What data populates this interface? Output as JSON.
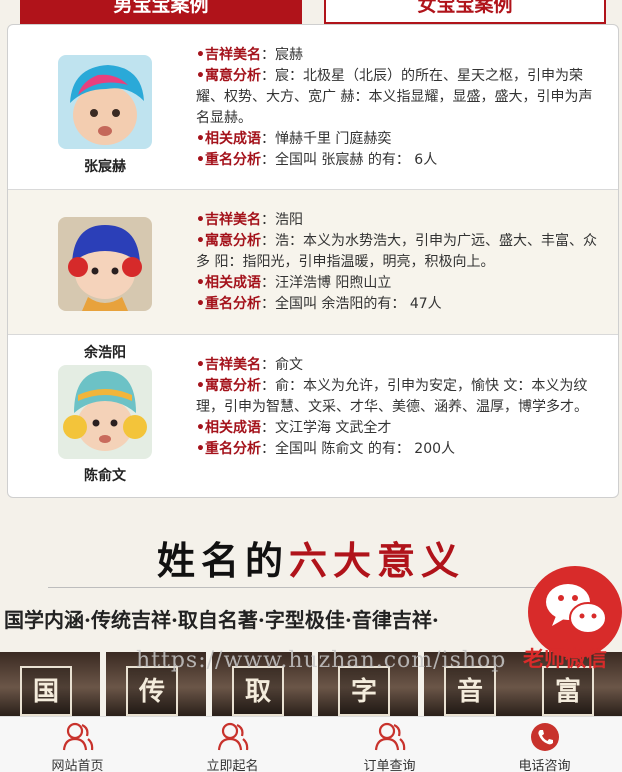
{
  "tabs": {
    "boy": "男宝宝案例",
    "girl": "女宝宝案例"
  },
  "labels": {
    "name": "•吉祥美名",
    "meaning": "•寓意分析",
    "idiom": "•相关成语",
    "dup": "•重名分析"
  },
  "cases": [
    {
      "baby_name": "张宸赫",
      "name": "：宸赫",
      "meaning": "：宸：北极星（北辰）的所在、星天之枢，引申为荣耀、权势、大方、宽广 赫：本义指显耀，显盛，盛大，引申为声名显赫。",
      "idiom": "：惮赫千里 门庭赫奕",
      "dup": "：全国叫 张宸赫 的有： 6人"
    },
    {
      "baby_name": "余浩阳",
      "name": "：浩阳",
      "meaning": "：浩：本义为水势浩大，引申为广远、盛大、丰富、众多 阳：指阳光，引申指温暖，明亮，积极向上。",
      "idiom": "：汪洋浩博 阳煦山立",
      "dup": "：全国叫 余浩阳的有： 47人"
    },
    {
      "baby_name": "陈俞文",
      "name": "：俞文",
      "meaning": "：俞：本义为允许，引申为安定，愉快 文：本义为纹理，引申为智慧、文采、才华、美德、涵养、温厚，博学多才。",
      "idiom": "：文江学海 文武全才",
      "dup": "：全国叫 陈俞文 的有： 200人"
    }
  ],
  "section": {
    "title_black": "姓名的",
    "title_red": "六大意义",
    "meanings": "国学内涵·传统吉祥·取自名著·字型极佳·音律吉祥·",
    "tiles": [
      "国",
      "传",
      "取",
      "字",
      "音",
      "富"
    ],
    "watermark": "https://www.huzhan.com/ishop",
    "wechat": "老师微信"
  },
  "footer": [
    "网站首页",
    "立即起名",
    "订单查询",
    "电话咨询"
  ],
  "colors": {
    "brand_red": "#b0131a",
    "wechat_red": "#d82b2a"
  }
}
